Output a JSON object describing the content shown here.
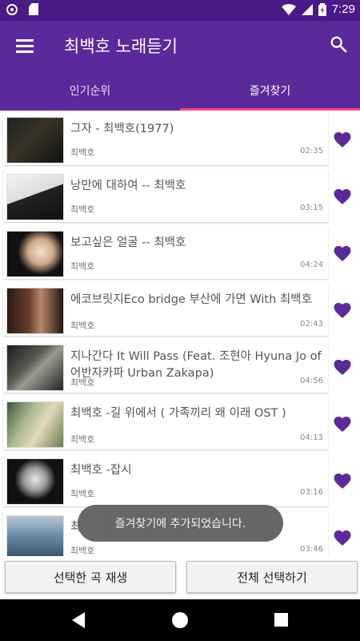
{
  "status": {
    "time": "7:29"
  },
  "app": {
    "title": "최백호 노래듣기"
  },
  "tabs": [
    {
      "label": "인기순위",
      "active": false
    },
    {
      "label": "즐겨찾기",
      "active": true
    }
  ],
  "colors": {
    "appbar": "#5b2a9a",
    "statusbar": "#4a1a86",
    "tab_indicator": "#ff4081",
    "heart": "#5b2a9a"
  },
  "songs": [
    {
      "title": "그자 - 최백호(1977)",
      "artist": "최백호",
      "duration": "02:35",
      "favorite": true
    },
    {
      "title": "낭만에 대하여 -- 최백호",
      "artist": "최백호",
      "duration": "03:15",
      "favorite": true
    },
    {
      "title": "보고싶은 얼굴 -- 최백호",
      "artist": "최백호",
      "duration": "04:24",
      "favorite": true
    },
    {
      "title": "에코브릿지Eco bridge 부산에 가면 With 최백호",
      "artist": "최백호",
      "duration": "02:43",
      "favorite": true
    },
    {
      "title": "지나간다 It Will Pass (Feat. 조현아 Hyuna Jo of 어반자카파 Urban Zakapa)",
      "artist": "최백호",
      "duration": "04:56",
      "favorite": true
    },
    {
      "title": "최백호 -길 위에서 ( 가족끼리 왜 이래 OST )",
      "artist": "최백호",
      "duration": "04:13",
      "favorite": true
    },
    {
      "title": "최백호 -잡시",
      "artist": "최백호",
      "duration": "03:16",
      "favorite": true
    },
    {
      "title": "최",
      "artist": "최백호",
      "duration": "03:46",
      "favorite": true
    }
  ],
  "toast": "즐겨찾기에 추가되었습니다.",
  "buttons": {
    "play_selected": "선택한 곡 재생",
    "select_all": "전체 선택하기"
  }
}
